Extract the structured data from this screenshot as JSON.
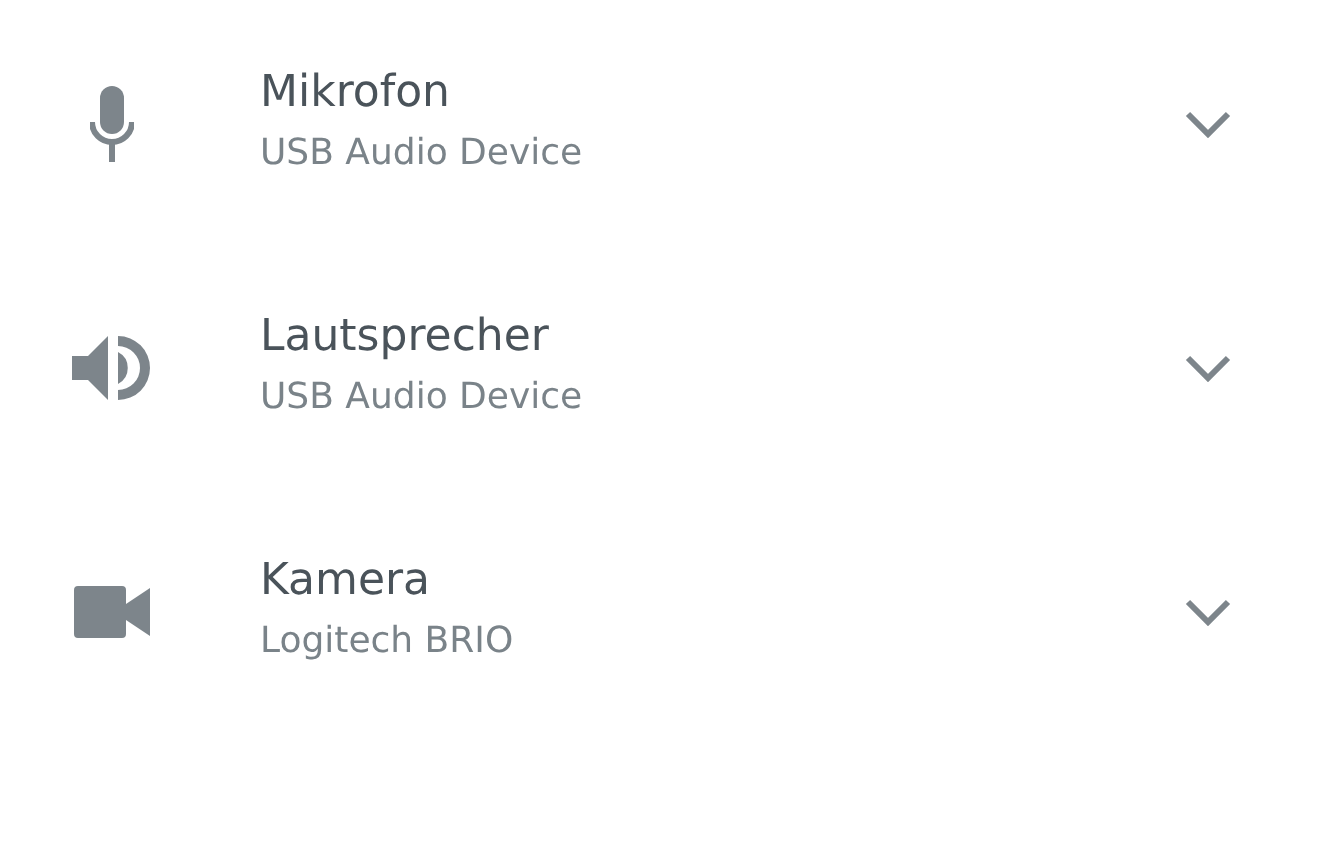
{
  "devices": [
    {
      "kind": "microphone",
      "title": "Mikrofon",
      "subtitle": "USB Audio Device",
      "expanded": false
    },
    {
      "kind": "speaker",
      "title": "Lautsprecher",
      "subtitle": "USB Audio Device",
      "expanded": false
    },
    {
      "kind": "camera",
      "title": "Kamera",
      "subtitle": "Logitech BRIO",
      "expanded": false
    }
  ]
}
